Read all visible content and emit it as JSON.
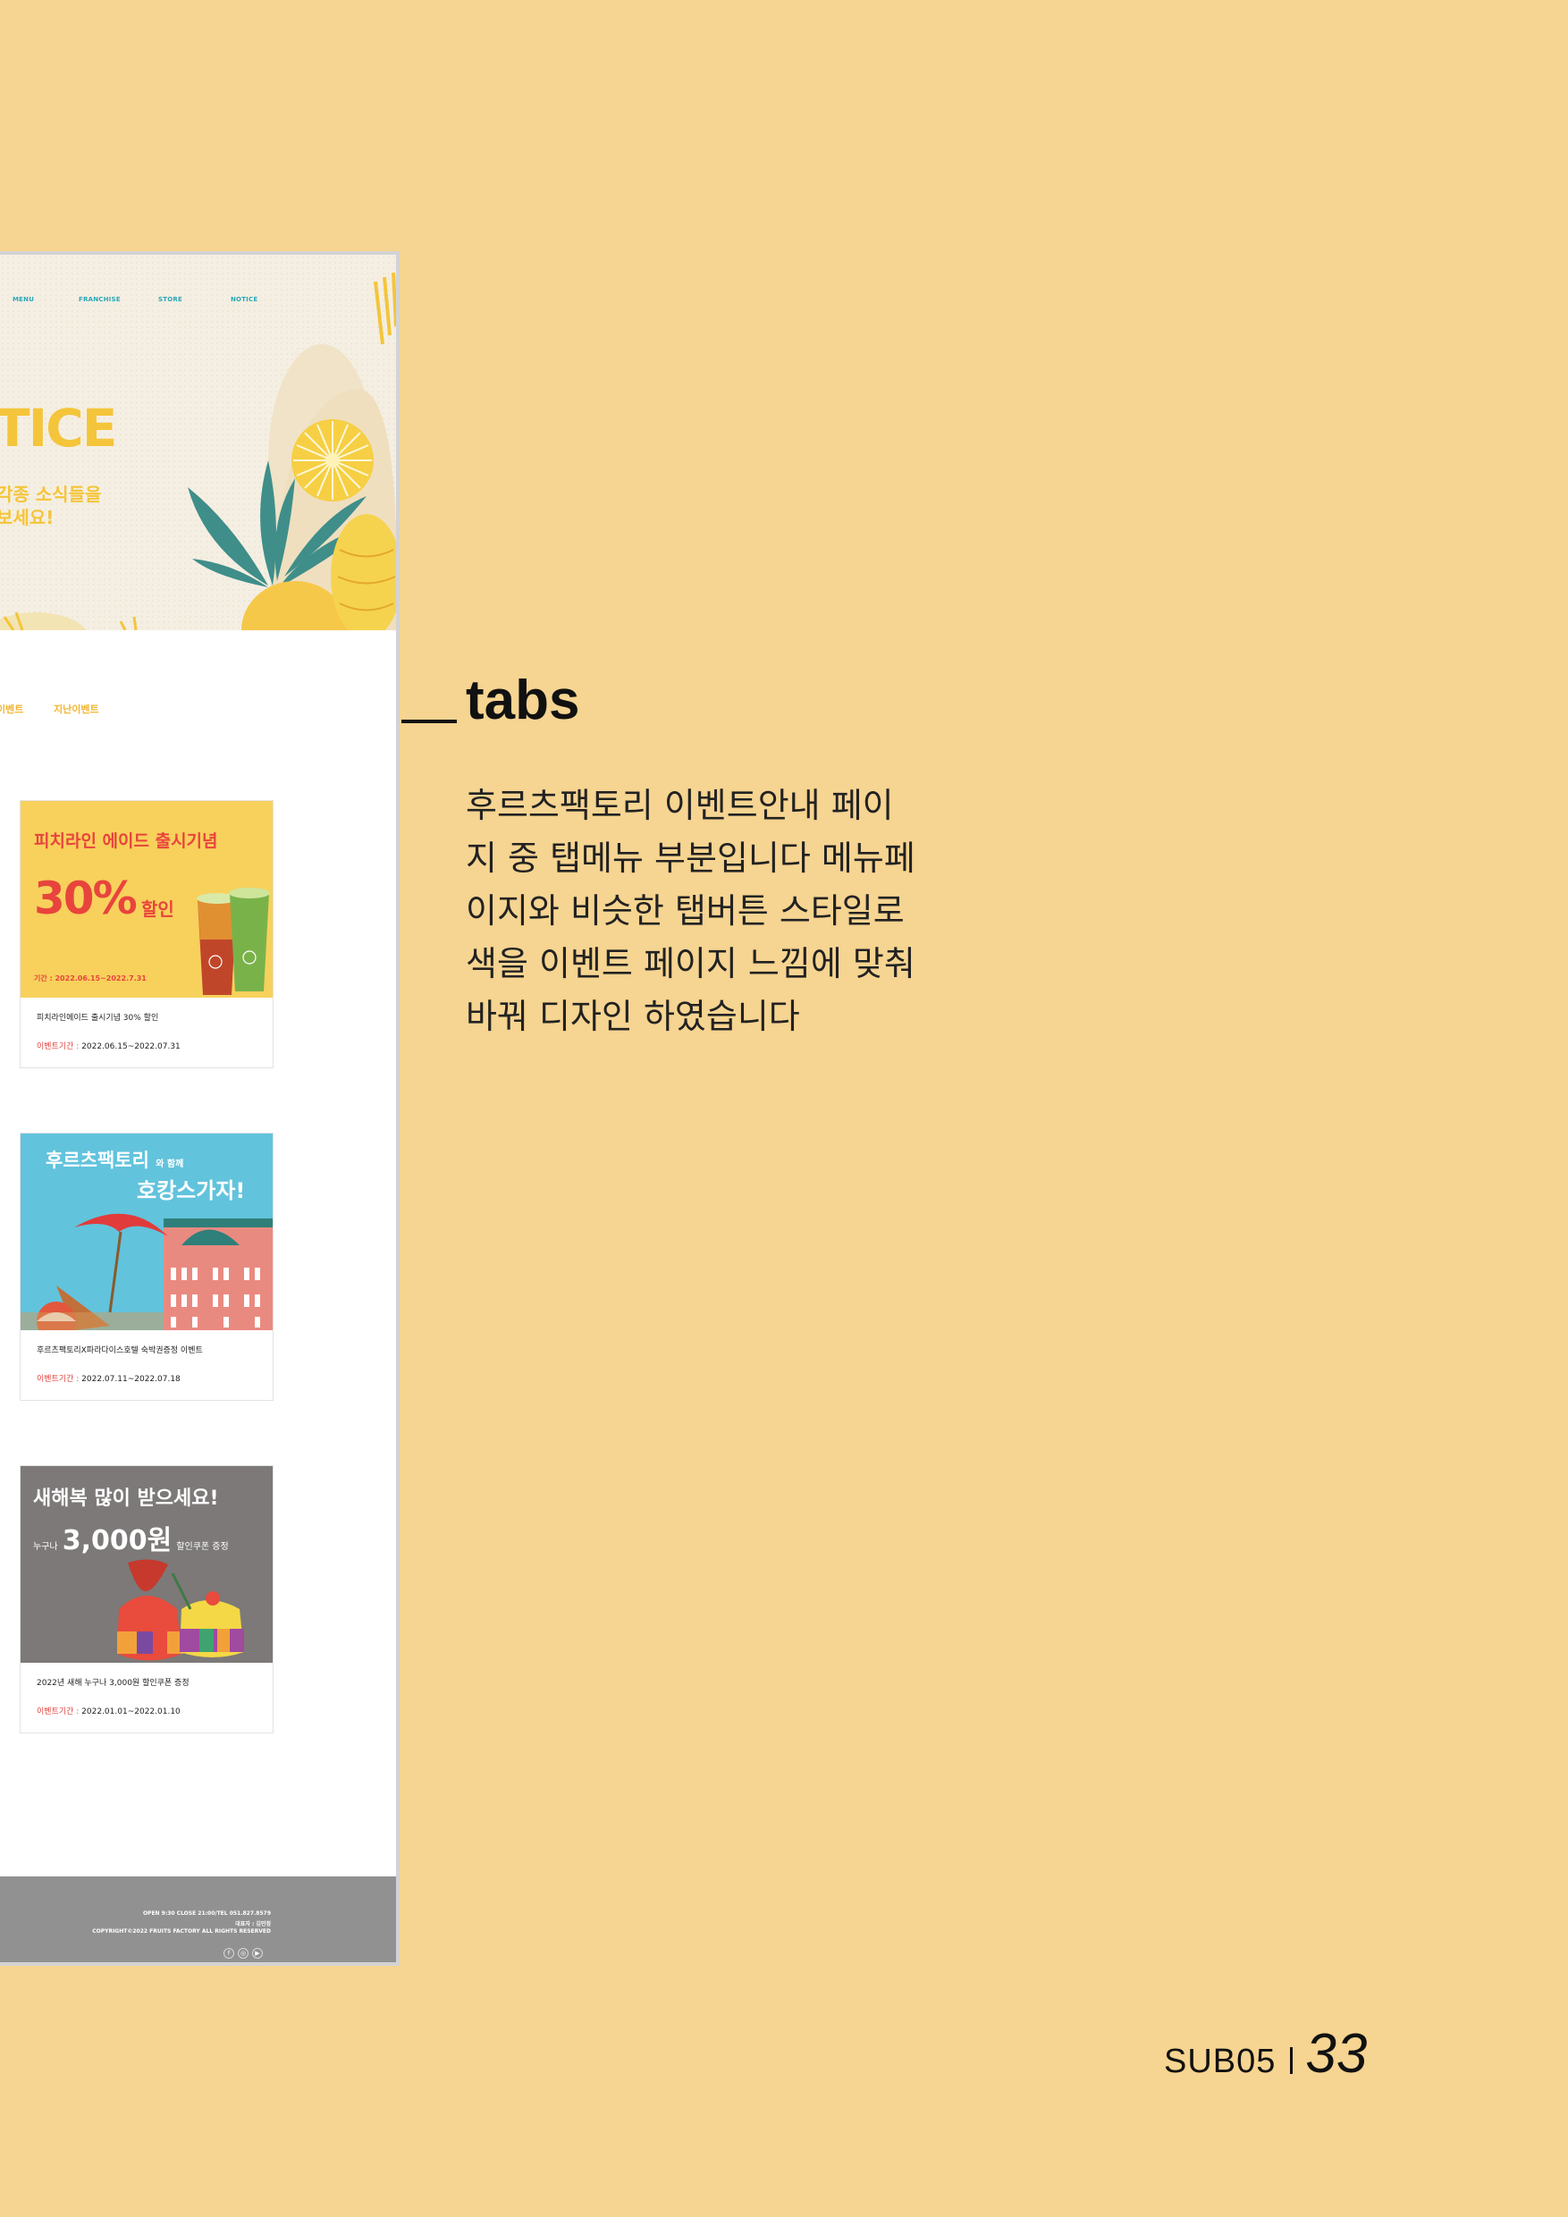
{
  "mockup": {
    "nav": [
      "MENU",
      "FRANCHISE",
      "STORE",
      "NOTICE"
    ],
    "hero_title": "TICE",
    "hero_sub_1": "각종 소식들을",
    "hero_sub_2": "보세요!",
    "tabs": [
      "이벤트",
      "지난이벤트"
    ],
    "cards": [
      {
        "banner_headline": "피치라인 에이드 출시기념",
        "banner_big": "30%",
        "banner_big_suffix": "할인",
        "banner_period": "기간 : 2022.06.15~2022.7.31",
        "title": "피치라인에이드 출시기념 30% 할인",
        "period_label": "이벤트기간 :",
        "period_value": "2022.06.15~2022.07.31"
      },
      {
        "banner_headline": "후르츠팩토리",
        "banner_headline_suffix": "와 함께",
        "banner_big": "호캉스가자!",
        "title": "후르츠팩토리X파라다이스호텔 숙박권증정 이벤트",
        "period_label": "이벤트기간 :",
        "period_value": "2022.07.11~2022.07.18"
      },
      {
        "banner_headline": "새해복 많이 받으세요!",
        "banner_prefix": "누구나",
        "banner_big": "3,000원",
        "banner_big_suffix": "할인쿠폰 증정",
        "title": "2022년 새해 누구나 3,000원 할인쿠폰 증정",
        "period_label": "이벤트기간 :",
        "period_value": "2022.01.01~2022.01.10"
      }
    ],
    "footer": {
      "line1": "OPEN 9:30 CLOSE 21:00/TEL 051.827.8579",
      "line2": "대표자 : 김민정",
      "line3": "COPYRIGHT©2022 FRUITS FACTORY ALL RIGHTS RESERVED",
      "sns_icons": [
        "facebook-icon",
        "instagram-icon",
        "youtube-icon"
      ]
    }
  },
  "annotation": {
    "title": "tabs",
    "desc_lines": [
      "후르츠팩토리 이벤트안내 페이",
      "지 중 탭메뉴 부분입니다 메뉴페",
      "이지와 비슷한 탭버튼 스타일로",
      "색을 이벤트 페이지 느낌에 맞춰",
      "바꿔 디자인 하였습니다"
    ]
  },
  "page": {
    "section": "SUB05",
    "number": "33"
  },
  "colors": {
    "background": "#f6d491",
    "accent_yellow": "#f4c53a",
    "nav_teal": "#2aa6b6",
    "period_red": "#e0433e",
    "footer_gray": "#919191"
  }
}
